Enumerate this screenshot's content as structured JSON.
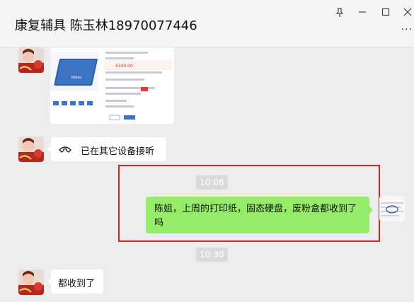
{
  "header": {
    "title": "康复辅具 陈玉林18970077446",
    "pin_icon": "pin-icon",
    "minimize_icon": "minimize-icon",
    "maximize_icon": "maximize-icon",
    "close_icon": "close-icon",
    "more_icon": "more-icon"
  },
  "messages": [
    {
      "id": "m1",
      "side": "left",
      "type": "image",
      "alt": "product-screenshot",
      "product_label": "Netac",
      "price": "¥349.00"
    },
    {
      "id": "m2",
      "side": "left",
      "type": "call",
      "icon": "phone-icon",
      "text": "已在其它设备接听"
    },
    {
      "id": "t1",
      "type": "timestamp",
      "text": "10:08"
    },
    {
      "id": "m3",
      "side": "right",
      "type": "text",
      "text": "陈姐，上周的打印纸，固态硬盘，废粉盒都收到了吗"
    },
    {
      "id": "t2",
      "type": "timestamp",
      "text": "10:30"
    },
    {
      "id": "m4",
      "side": "left",
      "type": "text",
      "text": "都收到了"
    }
  ],
  "colors": {
    "accent_green": "#95ec69",
    "highlight_red": "#e32020"
  }
}
